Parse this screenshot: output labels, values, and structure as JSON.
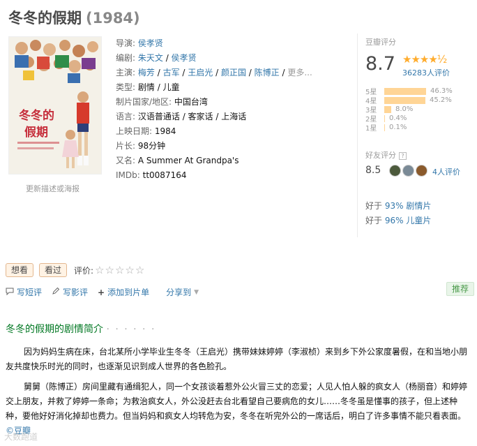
{
  "movie": {
    "title": "冬冬的假期",
    "year": "(1984)"
  },
  "poster": {
    "caption": "更新描述或海报",
    "art_text": "冬冬的假期"
  },
  "info": {
    "director": {
      "label": "导演:",
      "names": [
        "侯孝贤"
      ]
    },
    "writer": {
      "label": "编剧:",
      "names": [
        "朱天文",
        "侯孝贤"
      ]
    },
    "cast": {
      "label": "主演:",
      "names": [
        "梅芳",
        "古军",
        "王启光",
        "颜正国",
        "陈博正"
      ],
      "more": "更多..."
    },
    "genre": {
      "label": "类型:",
      "value": "剧情 / 儿童"
    },
    "region": {
      "label": "制片国家/地区:",
      "value": "中国台湾"
    },
    "language": {
      "label": "语言:",
      "value": "汉语普通话 / 客家话 / 上海话"
    },
    "release": {
      "label": "上映日期:",
      "value": "1984"
    },
    "runtime": {
      "label": "片长:",
      "value": "98分钟"
    },
    "aka": {
      "label": "又名:",
      "value": "A Summer At Grandpa's"
    },
    "imdb": {
      "label": "IMDb:",
      "value": "tt0087164"
    }
  },
  "rating": {
    "title": "豆瓣评分",
    "score": "8.7",
    "stars": "★★★★½",
    "count": "36283人评价",
    "bars": [
      {
        "label": "5星",
        "pct": "46.3%",
        "value": 46.3
      },
      {
        "label": "4星",
        "pct": "45.2%",
        "value": 45.2
      },
      {
        "label": "3星",
        "pct": "8.0%",
        "value": 8.0
      },
      {
        "label": "2星",
        "pct": "0.4%",
        "value": 0.4
      },
      {
        "label": "1星",
        "pct": "0.1%",
        "value": 0.1
      }
    ],
    "friends_title": "好友评分",
    "friends_help": "?",
    "friends_score": "8.5",
    "friends_count": "4人评价",
    "better_than": [
      {
        "prefix": "好于 ",
        "pct": "93%",
        "genre": " 剧情片"
      },
      {
        "prefix": "好于 ",
        "pct": "96%",
        "genre": " 儿童片"
      }
    ]
  },
  "actions": {
    "want": "想看",
    "seen": "看过",
    "rate_label": "评价:",
    "rate_stars": "☆☆☆☆☆"
  },
  "links": {
    "short_review": "写短评",
    "review": "写影评",
    "add_list": "添加到片单",
    "share": "分享到",
    "recommend": "推荐"
  },
  "section": {
    "title": "冬冬的假期的剧情简介",
    "dots": "· · · · · ·"
  },
  "summary": {
    "p1": "因为妈妈生病在床，台北某所小学毕业生冬冬（王启光）携带妹妹婷婷（李淑桢）来到乡下外公家度暑假，在和当地小朋友共度快乐时光的同时，也逐渐见识到成人世界的各色脸孔。",
    "p2": "舅舅（陈博正）房间里藏有通缉犯人，同一个女孩谈着惹外公火冒三丈的恋爱；人见人怕人躲的疯女人（杨丽音）和婷婷交上朋友，并救了婷婷一条命；为救治疯女人，外公没赶去台北看望自己要病危的女儿……冬冬虽是懂事的孩子，但上述种种，要他好好消化掉却也费力。但当妈妈和疯女人均转危为安，冬冬在听完外公的一席话后，明白了许多事情不能只看表面。",
    "source": "©豆瓣"
  },
  "watermark": "大数跑道"
}
